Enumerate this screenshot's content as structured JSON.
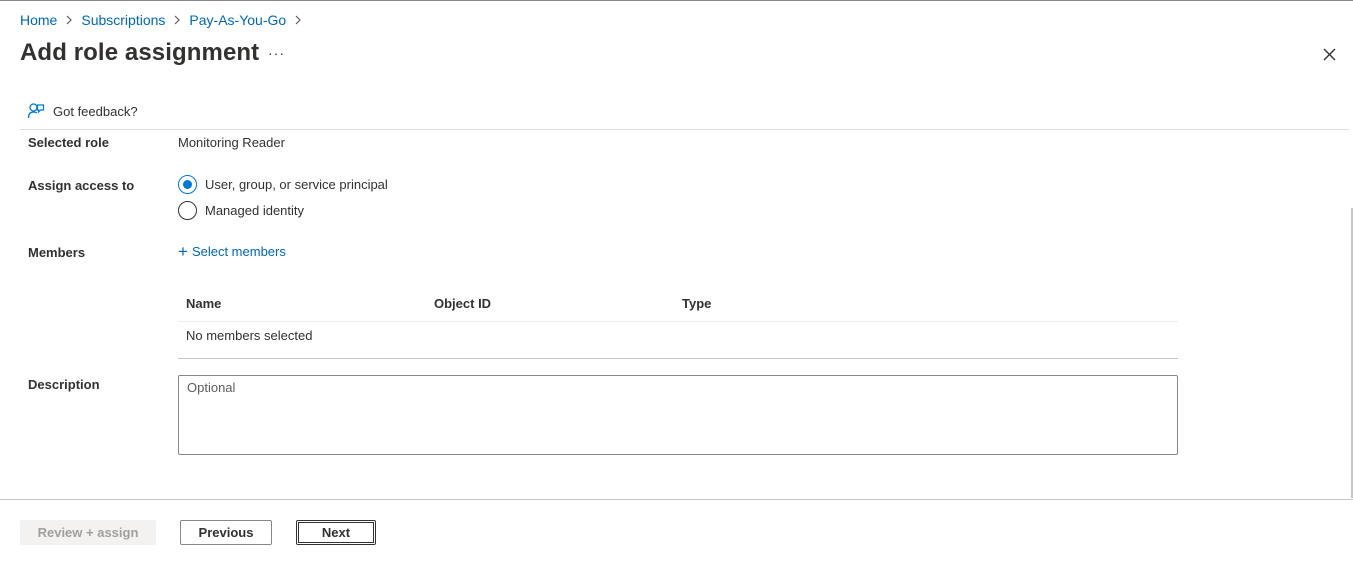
{
  "breadcrumb": {
    "items": [
      "Home",
      "Subscriptions",
      "Pay-As-You-Go"
    ]
  },
  "header": {
    "title": "Add role assignment",
    "more_label": "···"
  },
  "feedback": {
    "label": "Got feedback?"
  },
  "form": {
    "selected_role": {
      "label": "Selected role",
      "value": "Monitoring Reader"
    },
    "assign_access": {
      "label": "Assign access to",
      "options": [
        {
          "label": "User, group, or service principal",
          "checked": true
        },
        {
          "label": "Managed identity",
          "checked": false
        }
      ]
    },
    "members": {
      "label": "Members",
      "select_label": "Select members",
      "columns": [
        "Name",
        "Object ID",
        "Type"
      ],
      "empty_text": "No members selected"
    },
    "description": {
      "label": "Description",
      "placeholder": "Optional"
    }
  },
  "footer": {
    "review_label": "Review + assign",
    "previous_label": "Previous",
    "next_label": "Next"
  },
  "colors": {
    "accent": "#0078d4",
    "link": "#0067b8"
  }
}
